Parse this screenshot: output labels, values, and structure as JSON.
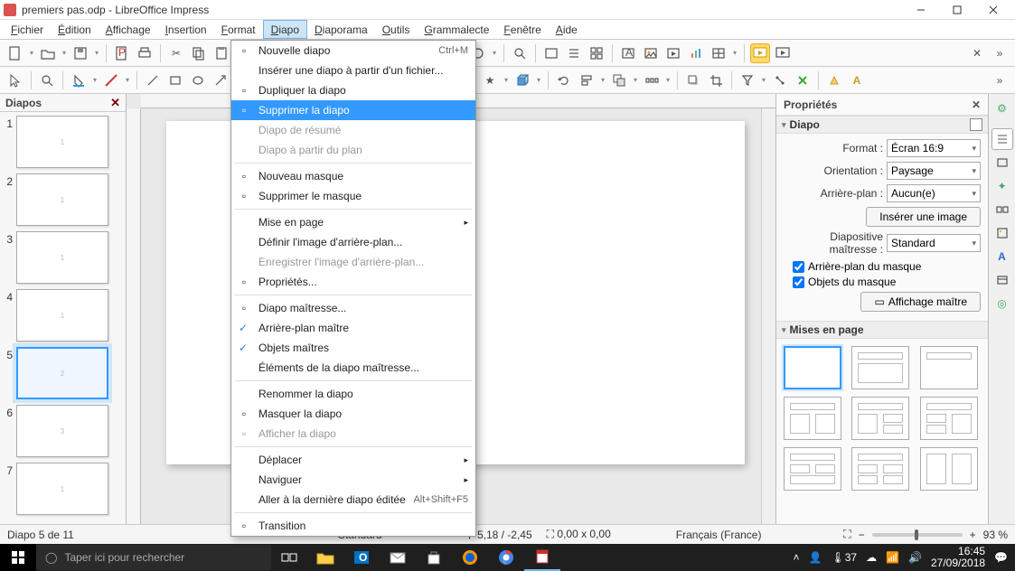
{
  "window": {
    "title": "premiers pas.odp - LibreOffice Impress"
  },
  "menubar": [
    "Fichier",
    "Édition",
    "Affichage",
    "Insertion",
    "Format",
    "Diapo",
    "Diaporama",
    "Outils",
    "Grammalecte",
    "Fenêtre",
    "Aide"
  ],
  "menubar_open_index": 5,
  "dropdown": {
    "items": [
      {
        "label": "Nouvelle diapo",
        "shortcut": "Ctrl+M",
        "icon": "new-slide"
      },
      {
        "label": "Insérer une diapo à partir d'un fichier..."
      },
      {
        "label": "Dupliquer la diapo",
        "icon": "duplicate"
      },
      {
        "label": "Supprimer la diapo",
        "highlighted": true,
        "icon": "delete-slide"
      },
      {
        "label": "Diapo de résumé",
        "disabled": true
      },
      {
        "label": "Diapo à partir du plan",
        "disabled": true
      },
      {
        "sep": true
      },
      {
        "label": "Nouveau masque",
        "icon": "new-master"
      },
      {
        "label": "Supprimer le masque",
        "icon": "delete-master"
      },
      {
        "sep": true
      },
      {
        "label": "Mise en page",
        "submenu": true
      },
      {
        "label": "Définir l'image d'arrière-plan..."
      },
      {
        "label": "Enregistrer l'image d'arrière-plan...",
        "disabled": true
      },
      {
        "label": "Propriétés...",
        "icon": "properties"
      },
      {
        "sep": true
      },
      {
        "label": "Diapo maîtresse...",
        "icon": "master-slide"
      },
      {
        "label": "Arrière-plan maître",
        "checked": true
      },
      {
        "label": "Objets maîtres",
        "checked": true
      },
      {
        "label": "Éléments de la diapo maîtresse..."
      },
      {
        "sep": true
      },
      {
        "label": "Renommer la diapo"
      },
      {
        "label": "Masquer la diapo",
        "icon": "hide-slide"
      },
      {
        "label": "Afficher la diapo",
        "disabled": true,
        "icon": "show-slide"
      },
      {
        "sep": true
      },
      {
        "label": "Déplacer",
        "submenu": true
      },
      {
        "label": "Naviguer",
        "submenu": true
      },
      {
        "label": "Aller à la dernière diapo éditée",
        "shortcut": "Alt+Shift+F5"
      },
      {
        "sep": true
      },
      {
        "label": "Transition",
        "icon": "transition"
      }
    ]
  },
  "slides_panel": {
    "title": "Diapos",
    "slides": [
      {
        "n": 1,
        "label": "1"
      },
      {
        "n": 2,
        "label": "1"
      },
      {
        "n": 3,
        "label": "1"
      },
      {
        "n": 4,
        "label": "1"
      },
      {
        "n": 5,
        "label": "2",
        "selected": true
      },
      {
        "n": 6,
        "label": "3"
      },
      {
        "n": 7,
        "label": "1"
      }
    ]
  },
  "properties": {
    "title": "Propriétés",
    "section_slide": "Diapo",
    "format_label": "Format :",
    "format_value": "Écran 16:9",
    "orientation_label": "Orientation :",
    "orientation_value": "Paysage",
    "background_label": "Arrière-plan :",
    "background_value": "Aucun(e)",
    "insert_image_btn": "Insérer une image",
    "master_label": "Diapositive maîtresse :",
    "master_value": "Standard",
    "check_bg": "Arrière-plan du masque",
    "check_objects": "Objets du masque",
    "master_view_btn": "Affichage maître",
    "section_layouts": "Mises en page"
  },
  "statusbar": {
    "slide_count": "Diapo 5 de 11",
    "master": "Standard",
    "coords": "5,18 / -2,45",
    "size": "0,00 x 0,00",
    "locale": "Français (France)",
    "zoom": "93 %"
  },
  "taskbar": {
    "search_placeholder": "Taper ici pour rechercher",
    "time": "16:45",
    "date": "27/09/2018",
    "temp": "37"
  }
}
